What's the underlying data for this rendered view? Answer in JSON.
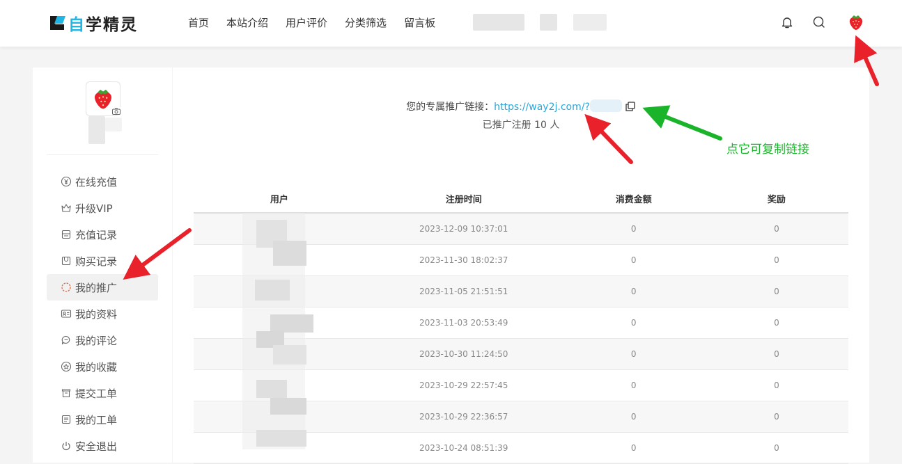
{
  "header": {
    "logo_text_hl": "自",
    "logo_text": "学精灵",
    "nav": [
      "首页",
      "本站介绍",
      "用户评价",
      "分类筛选",
      "留言板"
    ]
  },
  "sidebar": {
    "avatar_icon": "strawberry-icon",
    "items": [
      {
        "label": "在线充值",
        "icon": "yen-icon"
      },
      {
        "label": "升级VIP",
        "icon": "crown-icon"
      },
      {
        "label": "充值记录",
        "icon": "record-icon"
      },
      {
        "label": "购买记录",
        "icon": "bag-icon"
      },
      {
        "label": "我的推广",
        "icon": "promo-icon",
        "active": true
      },
      {
        "label": "我的资料",
        "icon": "id-card-icon"
      },
      {
        "label": "我的评论",
        "icon": "comment-icon"
      },
      {
        "label": "我的收藏",
        "icon": "star-icon"
      },
      {
        "label": "提交工单",
        "icon": "inbox-icon"
      },
      {
        "label": "我的工单",
        "icon": "ticket-icon"
      },
      {
        "label": "安全退出",
        "icon": "power-icon"
      }
    ]
  },
  "referral": {
    "prefix": "您的专属推广链接：",
    "link": "https://way2j.com/?",
    "count_text": "已推广注册 10 人"
  },
  "table": {
    "headers": [
      "用户",
      "注册时间",
      "消费金额",
      "奖励"
    ],
    "rows": [
      {
        "user": "",
        "time": "2023-12-09 10:37:01",
        "amount": "0",
        "reward": "0"
      },
      {
        "user": "",
        "time": "2023-11-30 18:02:37",
        "amount": "0",
        "reward": "0"
      },
      {
        "user": "",
        "time": "2023-11-05 21:51:51",
        "amount": "0",
        "reward": "0"
      },
      {
        "user": "",
        "time": "2023-11-03 20:53:49",
        "amount": "0",
        "reward": "0"
      },
      {
        "user": "",
        "time": "2023-10-30 11:24:50",
        "amount": "0",
        "reward": "0"
      },
      {
        "user": "",
        "time": "2023-10-29 22:57:45",
        "amount": "0",
        "reward": "0"
      },
      {
        "user": "",
        "time": "2023-10-29 22:36:57",
        "amount": "0",
        "reward": "0"
      },
      {
        "user": "",
        "time": "2023-10-24 08:51:39",
        "amount": "0",
        "reward": "0"
      }
    ]
  },
  "annotation": {
    "label": "点它可复制链接",
    "arrow_color": "#e8212b",
    "label_color": "#1ab42a"
  }
}
